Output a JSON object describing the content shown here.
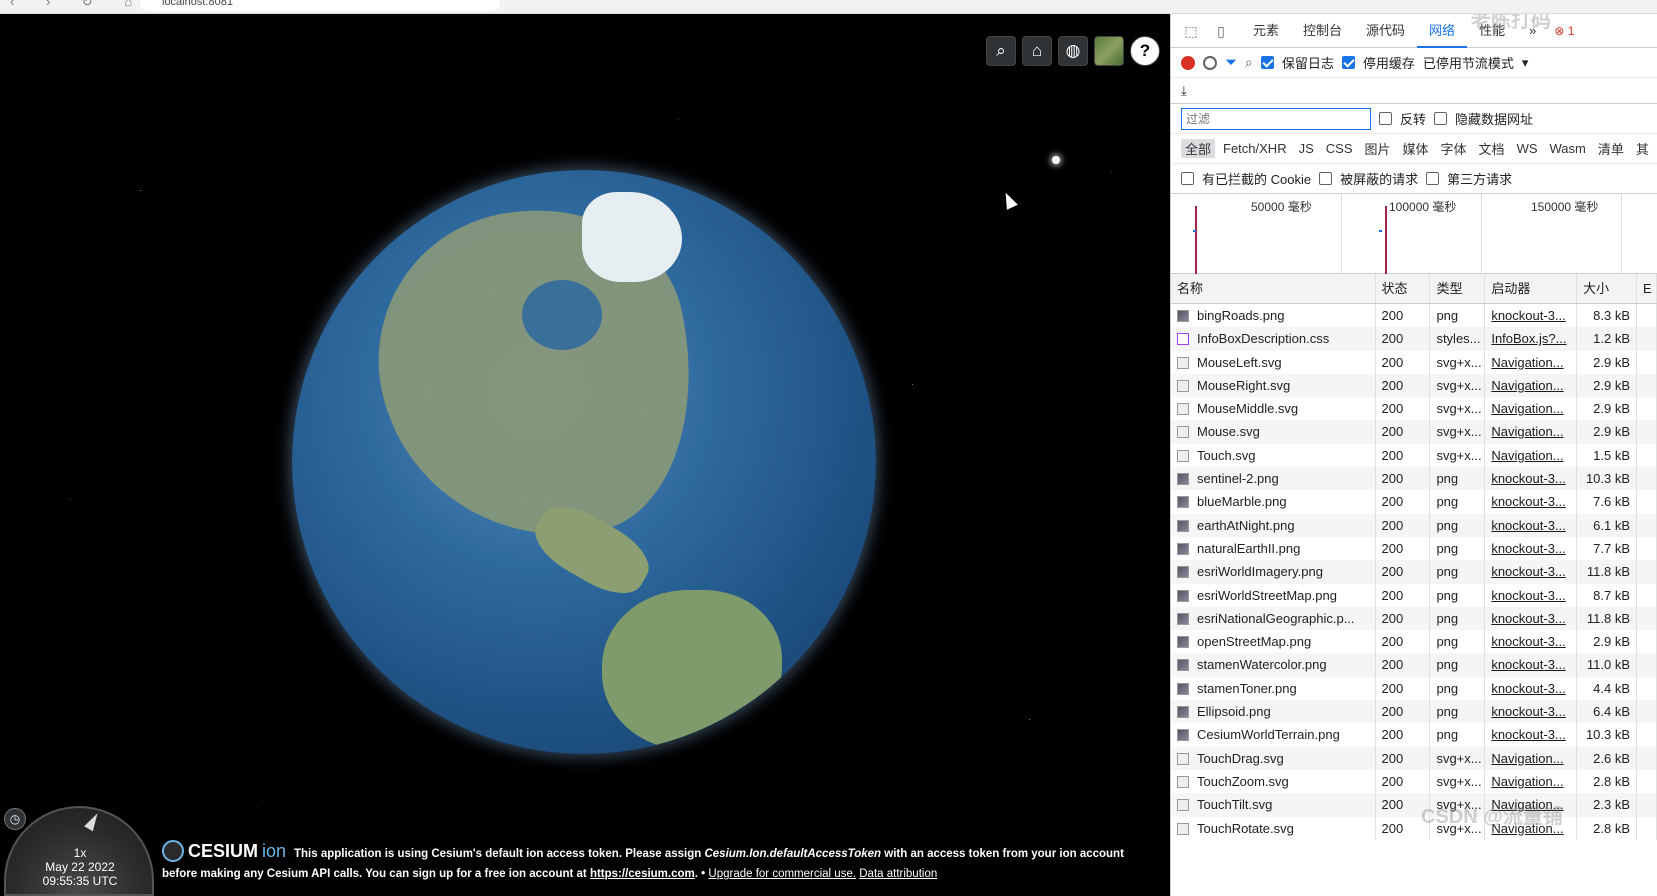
{
  "browser": {
    "url": "localhost:8081"
  },
  "viewer": {
    "toolbar": {
      "search": "⌕",
      "home": "⌂",
      "scene_mode": "◍",
      "help": "?"
    },
    "clock": {
      "speed": "1x",
      "date": "May 22 2022",
      "time": "09:55:35 UTC"
    },
    "credits": {
      "logo_word": "CESIUM",
      "logo_ion": "ion",
      "line1_pre": "This application is using Cesium's default ion access token. Please assign ",
      "line1_code": "Cesium.Ion.defaultAccessToken",
      "line1_post": " with an access token from your ion account",
      "line2_pre": "before making any Cesium API calls. You can sign up for a free ion account at ",
      "line2_link": "https://cesium.com",
      "line2_mid": ". • ",
      "upgrade": "Upgrade for commercial use.",
      "attribution": "Data attribution"
    }
  },
  "devtools": {
    "tabs": [
      "元素",
      "控制台",
      "源代码",
      "网络",
      "性能"
    ],
    "active_tab": "网络",
    "more_tabs": "»",
    "error_badge": "⊗ 1",
    "toolbar": {
      "preserve_log": "保留日志",
      "disable_cache": "停用缓存",
      "throttle": "已停用节流模式"
    },
    "filter": {
      "placeholder": "过滤",
      "invert": "反转",
      "hide_data_urls": "隐藏数据网址"
    },
    "types": [
      "全部",
      "Fetch/XHR",
      "JS",
      "CSS",
      "图片",
      "媒体",
      "字体",
      "文档",
      "WS",
      "Wasm",
      "清单",
      "其"
    ],
    "extra_filters": {
      "blocked_cookies": "有已拦截的 Cookie",
      "blocked_requests": "被屏蔽的请求",
      "third_party": "第三方请求"
    },
    "timeline": {
      "labels": [
        "50000 毫秒",
        "100000 毫秒",
        "150000 毫秒"
      ]
    },
    "table": {
      "headers": {
        "name": "名称",
        "status": "状态",
        "type": "类型",
        "initiator": "启动器",
        "size": "大小",
        "more": "E"
      },
      "rows": [
        {
          "name": "bingRoads.png",
          "status": "200",
          "type": "png",
          "initiator": "knockout-3...",
          "size": "8.3 kB",
          "icon": "img"
        },
        {
          "name": "InfoBoxDescription.css",
          "status": "200",
          "type": "styles...",
          "initiator": "InfoBox.js?...",
          "size": "1.2 kB",
          "icon": "css"
        },
        {
          "name": "MouseLeft.svg",
          "status": "200",
          "type": "svg+x...",
          "initiator": "Navigation...",
          "size": "2.9 kB",
          "icon": "svg"
        },
        {
          "name": "MouseRight.svg",
          "status": "200",
          "type": "svg+x...",
          "initiator": "Navigation...",
          "size": "2.9 kB",
          "icon": "svg"
        },
        {
          "name": "MouseMiddle.svg",
          "status": "200",
          "type": "svg+x...",
          "initiator": "Navigation...",
          "size": "2.9 kB",
          "icon": "svg"
        },
        {
          "name": "Mouse.svg",
          "status": "200",
          "type": "svg+x...",
          "initiator": "Navigation...",
          "size": "2.9 kB",
          "icon": "svg"
        },
        {
          "name": "Touch.svg",
          "status": "200",
          "type": "svg+x...",
          "initiator": "Navigation...",
          "size": "1.5 kB",
          "icon": "svg"
        },
        {
          "name": "sentinel-2.png",
          "status": "200",
          "type": "png",
          "initiator": "knockout-3...",
          "size": "10.3 kB",
          "icon": "img"
        },
        {
          "name": "blueMarble.png",
          "status": "200",
          "type": "png",
          "initiator": "knockout-3...",
          "size": "7.6 kB",
          "icon": "img"
        },
        {
          "name": "earthAtNight.png",
          "status": "200",
          "type": "png",
          "initiator": "knockout-3...",
          "size": "6.1 kB",
          "icon": "img"
        },
        {
          "name": "naturalEarthII.png",
          "status": "200",
          "type": "png",
          "initiator": "knockout-3...",
          "size": "7.7 kB",
          "icon": "img"
        },
        {
          "name": "esriWorldImagery.png",
          "status": "200",
          "type": "png",
          "initiator": "knockout-3...",
          "size": "11.8 kB",
          "icon": "img"
        },
        {
          "name": "esriWorldStreetMap.png",
          "status": "200",
          "type": "png",
          "initiator": "knockout-3...",
          "size": "8.7 kB",
          "icon": "img"
        },
        {
          "name": "esriNationalGeographic.p...",
          "status": "200",
          "type": "png",
          "initiator": "knockout-3...",
          "size": "11.8 kB",
          "icon": "img"
        },
        {
          "name": "openStreetMap.png",
          "status": "200",
          "type": "png",
          "initiator": "knockout-3...",
          "size": "2.9 kB",
          "icon": "img"
        },
        {
          "name": "stamenWatercolor.png",
          "status": "200",
          "type": "png",
          "initiator": "knockout-3...",
          "size": "11.0 kB",
          "icon": "img"
        },
        {
          "name": "stamenToner.png",
          "status": "200",
          "type": "png",
          "initiator": "knockout-3...",
          "size": "4.4 kB",
          "icon": "img"
        },
        {
          "name": "Ellipsoid.png",
          "status": "200",
          "type": "png",
          "initiator": "knockout-3...",
          "size": "6.4 kB",
          "icon": "img"
        },
        {
          "name": "CesiumWorldTerrain.png",
          "status": "200",
          "type": "png",
          "initiator": "knockout-3...",
          "size": "10.3 kB",
          "icon": "img"
        },
        {
          "name": "TouchDrag.svg",
          "status": "200",
          "type": "svg+x...",
          "initiator": "Navigation...",
          "size": "2.6 kB",
          "icon": "svg"
        },
        {
          "name": "TouchZoom.svg",
          "status": "200",
          "type": "svg+x...",
          "initiator": "Navigation...",
          "size": "2.8 kB",
          "icon": "svg"
        },
        {
          "name": "TouchTilt.svg",
          "status": "200",
          "type": "svg+x...",
          "initiator": "Navigation...",
          "size": "2.3 kB",
          "icon": "svg"
        },
        {
          "name": "TouchRotate.svg",
          "status": "200",
          "type": "svg+x...",
          "initiator": "Navigation...",
          "size": "2.8 kB",
          "icon": "svg"
        }
      ]
    },
    "watermark_top": "老陈打码",
    "watermark_bottom": "CSDN @流量铺"
  }
}
